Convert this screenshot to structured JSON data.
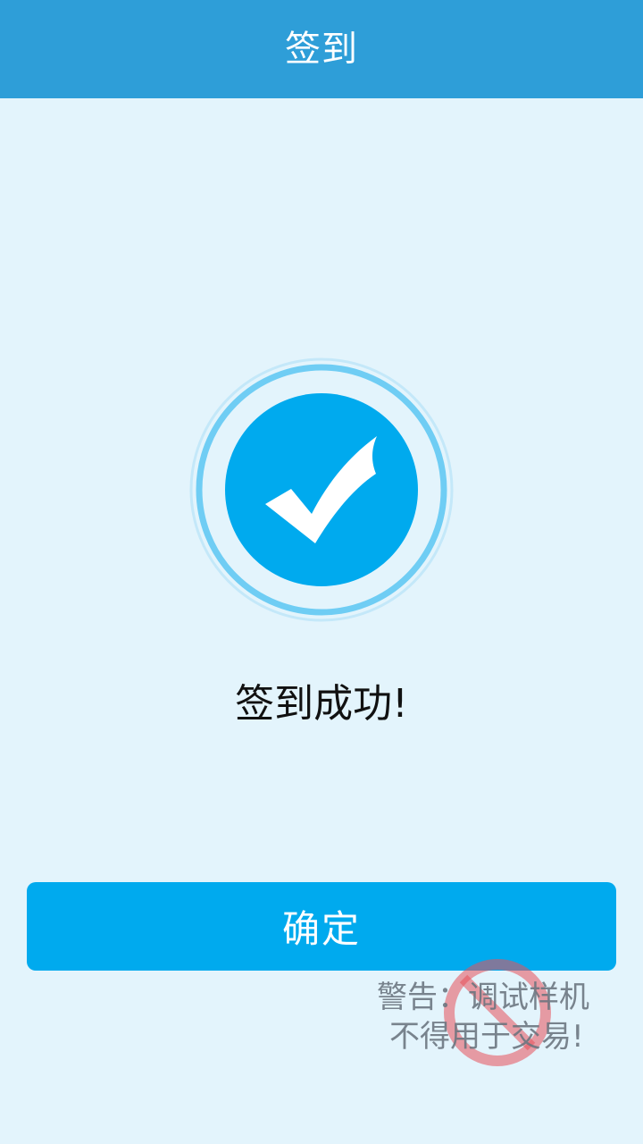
{
  "header": {
    "title": "签到"
  },
  "main": {
    "status_icon": "check-circle-icon",
    "success_message": "签到成功!",
    "confirm_label": "确定"
  },
  "watermark": {
    "line1": "警告：调试样机",
    "line2": "不得用于交易!",
    "stamp_icon": "prohibited-icon"
  },
  "colors": {
    "header_background": "#2e9ed8",
    "page_background": "#e3f4fc",
    "accent": "#00aaee",
    "watermark_stamp": "#e8505a"
  }
}
